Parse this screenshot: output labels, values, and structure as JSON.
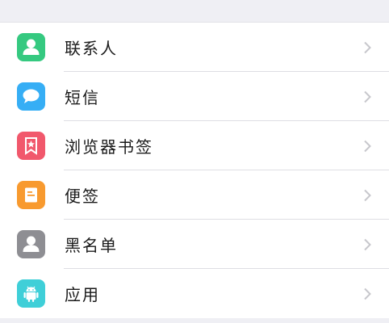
{
  "items": [
    {
      "label": "联系人",
      "icon": "contacts-icon",
      "color": "#35c980"
    },
    {
      "label": "短信",
      "icon": "message-icon",
      "color": "#36aef5"
    },
    {
      "label": "浏览器书签",
      "icon": "bookmark-icon",
      "color": "#f1586c"
    },
    {
      "label": "便签",
      "icon": "note-icon",
      "color": "#f89a2f"
    },
    {
      "label": "黑名单",
      "icon": "blacklist-icon",
      "color": "#8e8e93"
    },
    {
      "label": "应用",
      "icon": "android-app-icon",
      "color": "#3fcfd8"
    }
  ],
  "colors": {
    "background": "#efeff4",
    "row": "#ffffff",
    "separator": "#dedee3",
    "chevron": "#c7c7cc"
  }
}
